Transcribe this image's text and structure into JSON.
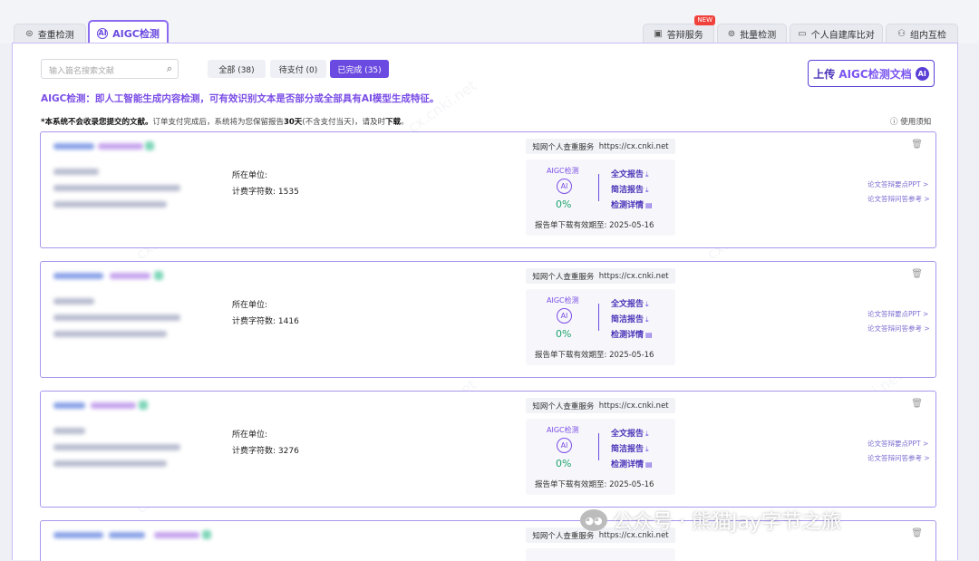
{
  "tabs": {
    "left": [
      {
        "label": "查重检测",
        "icon": "plagiarism-icon"
      },
      {
        "label": "AIGC检测",
        "icon": "ai-icon"
      }
    ],
    "right": [
      {
        "label": "答辩服务",
        "icon": "presentation-icon",
        "badge": "NEW"
      },
      {
        "label": "批量检测",
        "icon": "batch-icon"
      },
      {
        "label": "个人自建库比对",
        "icon": "database-icon"
      },
      {
        "label": "组内互检",
        "icon": "group-icon"
      }
    ]
  },
  "search": {
    "placeholder": "输入篇名搜索文献"
  },
  "filters": [
    {
      "label": "全部 (38)"
    },
    {
      "label": "待支付 (0)"
    },
    {
      "label": "已完成 (35)"
    }
  ],
  "upload": {
    "prefix": "上传",
    "highlight": "AIGC检测文档",
    "icon_text": "AI"
  },
  "description": "AIGC检测：即人工智能生成内容检测，可有效识别文本是否部分或全部具有AI模型生成特征。",
  "notice": {
    "bold": "*本系统不会收录您提交的文献。",
    "text": "订单支付完成后，系统将为您保留报告",
    "days": "30天",
    "text2": "(不含支付当天)，请及时",
    "download": "下载",
    "end": "。"
  },
  "help": "使用须知",
  "common": {
    "unit_label": "所在单位:",
    "chars_label_prefix": "计费字符数: ",
    "service_label": "知网个人查重服务",
    "service_url": "https://cx.cnki.net",
    "aigc_label": "AIGC检测",
    "ai_icon_text": "AI",
    "full_report": "全文报告",
    "brief_report": "简洁报告",
    "detail": "检测详情",
    "ppt_link": "论文答辩要点PPT >",
    "qa_link": "论文答辩问答参考 >"
  },
  "records": [
    {
      "chars": "计费字符数: 1535",
      "pct": "0%",
      "expiry": "报告单下载有效期至: 2025-05-16"
    },
    {
      "chars": "计费字符数: 1416",
      "pct": "0%",
      "expiry": "报告单下载有效期至: 2025-05-16"
    },
    {
      "chars": "计费字符数: 3276",
      "pct": "0%",
      "expiry": "报告单下载有效期至: 2025-05-16"
    },
    {
      "chars": "",
      "pct": "",
      "expiry": ""
    }
  ],
  "watermarks": {
    "site": "cx.cnki.net",
    "footer": "公众号 · 熊猫Jay字节之旅"
  },
  "colors": {
    "accent": "#6a4ae0",
    "success": "#1ea36c",
    "border": "#a996ee"
  }
}
